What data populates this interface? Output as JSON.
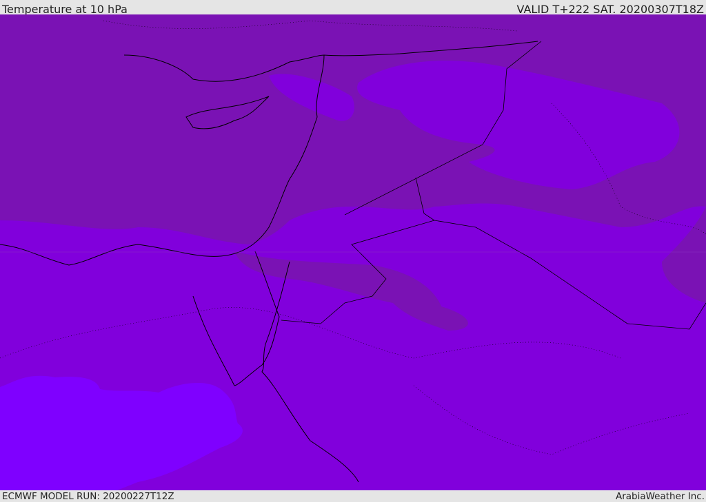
{
  "header": {
    "title": "Temperature at 10 hPa",
    "valid": "VALID T+222 SAT. 20200307T18Z"
  },
  "footer": {
    "model_run": "ECMWF MODEL RUN: 20200227T12Z",
    "credit": "ArabiaWeather Inc."
  },
  "colors": {
    "warm": "#7a12b4",
    "mid": "#8100dc",
    "cold": "#7f00ff",
    "coast": "#000000"
  }
}
